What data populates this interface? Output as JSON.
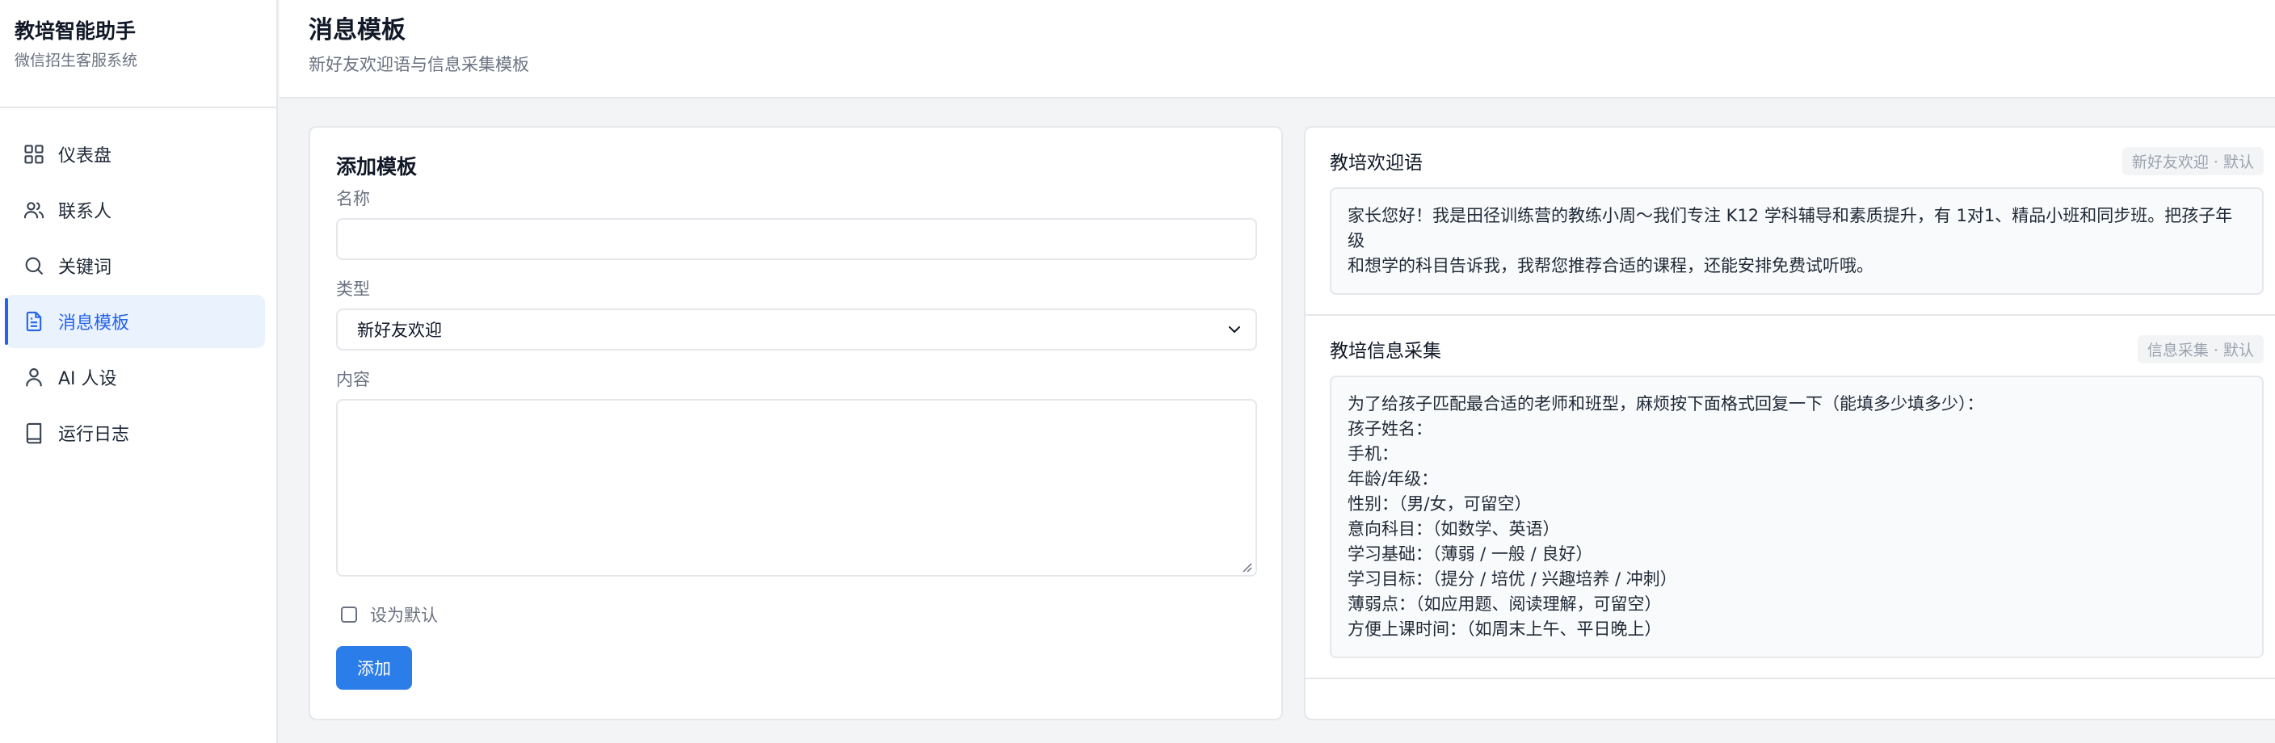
{
  "app": {
    "title": "教培智能助手",
    "subtitle": "微信招生客服系统"
  },
  "sidebar": {
    "items": [
      {
        "label": "仪表盘",
        "icon": "grid-icon"
      },
      {
        "label": "联系人",
        "icon": "users-icon"
      },
      {
        "label": "关键词",
        "icon": "search-icon"
      },
      {
        "label": "消息模板",
        "icon": "document-icon",
        "active": true
      },
      {
        "label": "AI 人设",
        "icon": "user-icon"
      },
      {
        "label": "运行日志",
        "icon": "book-icon"
      }
    ]
  },
  "header": {
    "title": "消息模板",
    "subtitle": "新好友欢迎语与信息采集模板"
  },
  "form": {
    "title": "添加模板",
    "name_label": "名称",
    "name_value": "",
    "type_label": "类型",
    "type_value": "新好友欢迎",
    "content_label": "内容",
    "content_value": "",
    "default_label": "设为默认",
    "default_checked": false,
    "submit_label": "添加"
  },
  "templates": [
    {
      "name": "教培欢迎语",
      "badge": "新好友欢迎 · 默认",
      "lines": [
        "家长您好！我是田径训练营的教练小周～我们专注 K12 学科辅导和素质提升，有 1对1、精品小班和同步班。把孩子年级",
        "和想学的科目告诉我，我帮您推荐合适的课程，还能安排免费试听哦。"
      ]
    },
    {
      "name": "教培信息采集",
      "badge": "信息采集 · 默认",
      "lines": [
        "为了给孩子匹配最合适的老师和班型，麻烦按下面格式回复一下（能填多少填多少）：",
        "孩子姓名：",
        "手机：",
        "年龄/年级：",
        "性别：（男/女，可留空）",
        "意向科目：（如数学、英语）",
        "学习基础：（薄弱 / 一般 / 良好）",
        "学习目标：（提分 / 培优 / 兴趣培养 / 冲刺）",
        "薄弱点：（如应用题、阅读理解，可留空）",
        "方便上课时间：（如周末上午、平日晚上）"
      ]
    }
  ],
  "colors": {
    "accent": "#2563eb",
    "button": "#2b7de9",
    "active_bg": "#eaf2fe",
    "page_bg": "#f3f4f6"
  }
}
